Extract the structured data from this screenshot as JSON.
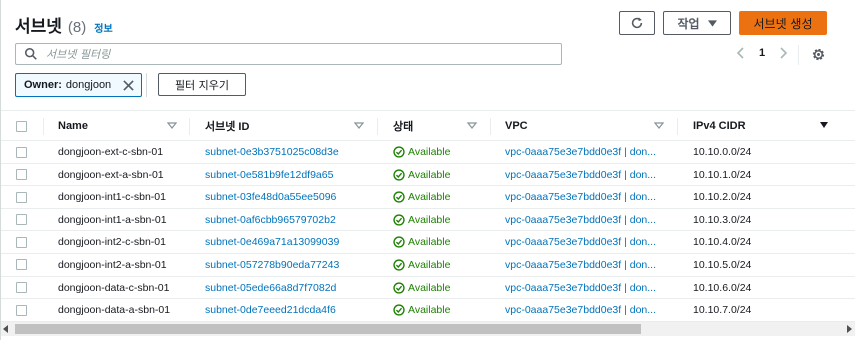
{
  "header": {
    "title": "서브넷",
    "count": "(8)",
    "info_label": "정보",
    "actions_label": "작업",
    "create_label": "서브넷 생성"
  },
  "search": {
    "placeholder": "서브넷 필터링",
    "value": ""
  },
  "pagination": {
    "current_page": "1"
  },
  "filter": {
    "token_key": "Owner:",
    "token_value": "dongjoon",
    "clear_label": "필터 지우기"
  },
  "table": {
    "columns": [
      "Name",
      "서브넷 ID",
      "상태",
      "VPC",
      "IPv4 CIDR"
    ],
    "rows": [
      {
        "name": "dongjoon-ext-c-sbn-01",
        "subnet_id": "subnet-0e3b3751025c08d3e",
        "state": "Available",
        "vpc": "vpc-0aaa75e3e7bdd0e3f | don...",
        "cidr": "10.10.0.0/24"
      },
      {
        "name": "dongjoon-ext-a-sbn-01",
        "subnet_id": "subnet-0e581b9fe12df9a65",
        "state": "Available",
        "vpc": "vpc-0aaa75e3e7bdd0e3f | don...",
        "cidr": "10.10.1.0/24"
      },
      {
        "name": "dongjoon-int1-c-sbn-01",
        "subnet_id": "subnet-03fe48d0a55ee5096",
        "state": "Available",
        "vpc": "vpc-0aaa75e3e7bdd0e3f | don...",
        "cidr": "10.10.2.0/24"
      },
      {
        "name": "dongjoon-int1-a-sbn-01",
        "subnet_id": "subnet-0af6cbb96579702b2",
        "state": "Available",
        "vpc": "vpc-0aaa75e3e7bdd0e3f | don...",
        "cidr": "10.10.3.0/24"
      },
      {
        "name": "dongjoon-int2-c-sbn-01",
        "subnet_id": "subnet-0e469a71a13099039",
        "state": "Available",
        "vpc": "vpc-0aaa75e3e7bdd0e3f | don...",
        "cidr": "10.10.4.0/24"
      },
      {
        "name": "dongjoon-int2-a-sbn-01",
        "subnet_id": "subnet-057278b90eda77243",
        "state": "Available",
        "vpc": "vpc-0aaa75e3e7bdd0e3f | don...",
        "cidr": "10.10.5.0/24"
      },
      {
        "name": "dongjoon-data-c-sbn-01",
        "subnet_id": "subnet-05ede66a8d7f7082d",
        "state": "Available",
        "vpc": "vpc-0aaa75e3e7bdd0e3f | don...",
        "cidr": "10.10.6.0/24"
      },
      {
        "name": "dongjoon-data-a-sbn-01",
        "subnet_id": "subnet-0de7eeed21dcda4f6",
        "state": "Available",
        "vpc": "vpc-0aaa75e3e7bdd0e3f | don...",
        "cidr": "10.10.7.0/24"
      }
    ]
  },
  "colors": {
    "primary_button": "#ec7211",
    "link": "#0073bb",
    "success": "#1d8102"
  }
}
